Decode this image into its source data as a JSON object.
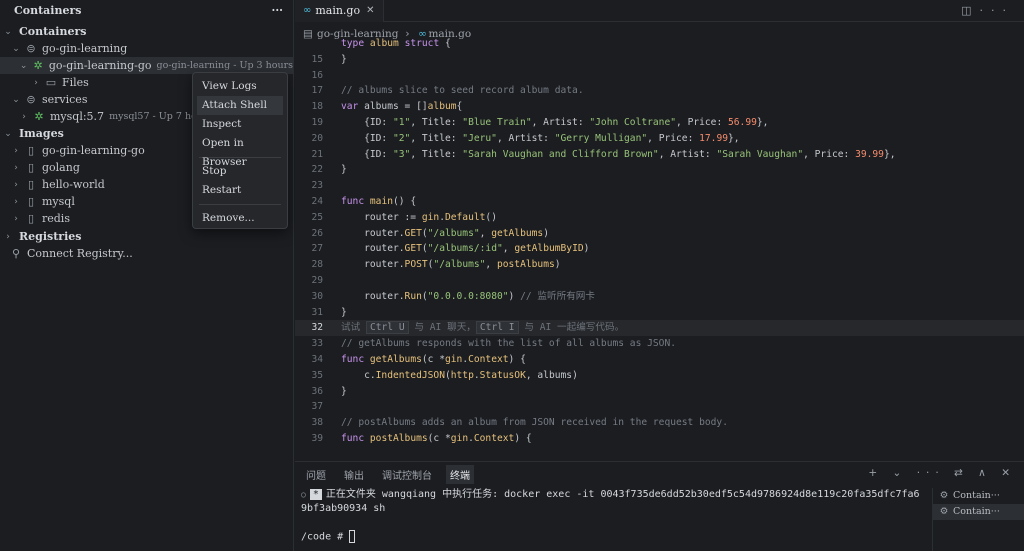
{
  "sidebar": {
    "title": "Containers",
    "more": "···",
    "containers": {
      "label": "Containers",
      "groups": [
        {
          "label": "go-gin-learning",
          "items": [
            {
              "label": "go-gin-learning-go",
              "sub": "go-gin-learning - Up 3 hours",
              "children": [
                "Files"
              ]
            }
          ]
        },
        {
          "label": "services",
          "items": [
            {
              "label": "mysql:5.7",
              "sub": "mysql57 - Up 7 hours"
            }
          ]
        }
      ]
    },
    "images": {
      "label": "Images",
      "items": [
        "go-gin-learning-go",
        "golang",
        "hello-world",
        "mysql",
        "redis"
      ]
    },
    "registries": {
      "label": "Registries",
      "connect": "Connect Registry..."
    }
  },
  "context_menu": {
    "items": [
      "View Logs",
      "Attach Shell",
      "Inspect",
      "Open in Browser",
      "Stop",
      "Restart",
      "Remove..."
    ]
  },
  "editor": {
    "tab": "main.go",
    "breadcrumb": [
      "go-gin-learning",
      "main.go"
    ],
    "current_line": 32,
    "lines": [
      {
        "n": "",
        "html": "<span class='k'>type</span> <span class='ty'>album</span> <span class='k'>struct</span> {"
      },
      {
        "n": "15",
        "html": "}"
      },
      {
        "n": "16",
        "html": ""
      },
      {
        "n": "17",
        "html": "<span class='c'>// albums slice to seed record album data.</span>"
      },
      {
        "n": "18",
        "html": "<span class='k'>var</span> <span class='v'>albums</span> = []<span class='ty'>album</span>{"
      },
      {
        "n": "19",
        "html": "    {ID: <span class='s'>\"1\"</span>, Title: <span class='s'>\"Blue Train\"</span>, Artist: <span class='s'>\"John Coltrane\"</span>, Price: <span class='nm'>56.99</span>},"
      },
      {
        "n": "20",
        "html": "    {ID: <span class='s'>\"2\"</span>, Title: <span class='s'>\"Jeru\"</span>, Artist: <span class='s'>\"Gerry Mulligan\"</span>, Price: <span class='nm'>17.99</span>},"
      },
      {
        "n": "21",
        "html": "    {ID: <span class='s'>\"3\"</span>, Title: <span class='s'>\"Sarah Vaughan and Clifford Brown\"</span>, Artist: <span class='s'>\"Sarah Vaughan\"</span>, Price: <span class='nm'>39.99</span>},"
      },
      {
        "n": "22",
        "html": "}"
      },
      {
        "n": "23",
        "html": ""
      },
      {
        "n": "24",
        "html": "<span class='k'>func</span> <span class='f'>main</span>() {"
      },
      {
        "n": "25",
        "html": "    router := <span class='ty'>gin</span>.<span class='f'>Default</span>()"
      },
      {
        "n": "26",
        "html": "    router.<span class='f'>GET</span>(<span class='s'>\"/albums\"</span>, <span class='f'>getAlbums</span>)"
      },
      {
        "n": "27",
        "html": "    router.<span class='f'>GET</span>(<span class='s'>\"/albums/:id\"</span>, <span class='f'>getAlbumByID</span>)"
      },
      {
        "n": "28",
        "html": "    router.<span class='f'>POST</span>(<span class='s'>\"/albums\"</span>, <span class='f'>postAlbums</span>)"
      },
      {
        "n": "29",
        "html": ""
      },
      {
        "n": "30",
        "html": "    router.<span class='f'>Run</span>(<span class='s'>\"0.0.0.0:8080\"</span>) <span class='c'>// 监听所有网卡</span>"
      },
      {
        "n": "31",
        "html": "}"
      },
      {
        "n": "32",
        "html": "<span class='hint'>试试 <span class='kbd'>Ctrl U</span> 与 AI 聊天，<span class='kbd'>Ctrl I</span> 与 AI 一起编写代码。</span>"
      },
      {
        "n": "33",
        "html": "<span class='c'>// getAlbums responds with the list of all albums as JSON.</span>"
      },
      {
        "n": "34",
        "html": "<span class='k'>func</span> <span class='f'>getAlbums</span>(c *<span class='ty'>gin</span>.<span class='ty'>Context</span>) {"
      },
      {
        "n": "35",
        "html": "    c.<span class='f'>IndentedJSON</span>(<span class='ty'>http</span>.<span class='ty'>StatusOK</span>, albums)"
      },
      {
        "n": "36",
        "html": "}"
      },
      {
        "n": "37",
        "html": ""
      },
      {
        "n": "38",
        "html": "<span class='c'>// postAlbums adds an album from JSON received in the request body.</span>"
      },
      {
        "n": "39",
        "html": "<span class='k'>func</span> <span class='f'>postAlbums</span>(c *<span class='ty'>gin</span>.<span class='ty'>Context</span>) {"
      }
    ]
  },
  "panel": {
    "tabs": [
      "问题",
      "输出",
      "调试控制台",
      "终端"
    ],
    "active_tab": "终端",
    "controls": "+ ⌄ ···   ⇄ ∧ ✕",
    "terminal": {
      "task_star": "*",
      "task_line": "正在文件夹 wangqiang 中执行任务: docker exec -it 0043f735de6dd52b30edf5c54d9786924d8e119c20fa35dfc7fa6",
      "task_line2": "9bf3ab90934 sh",
      "prompt": "/code # "
    },
    "terminals": [
      "Contain···",
      "Contain···"
    ]
  }
}
